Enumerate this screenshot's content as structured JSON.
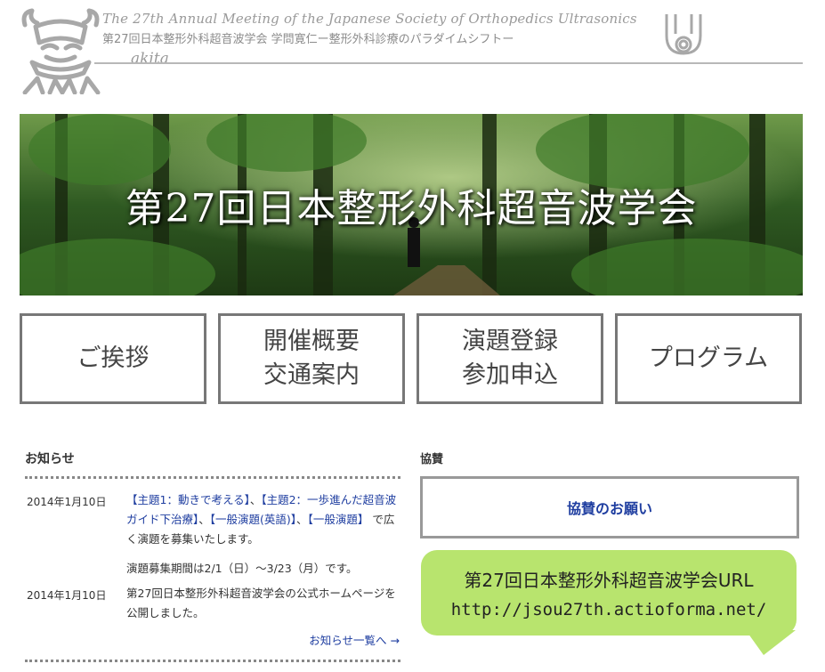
{
  "header": {
    "title_en": "The 27th Annual Meeting of the Japanese Society of Orthopedics Ultrasonics",
    "title_jp": "第27回日本整形外科超音波学会 学問寛仁ー整形外科診療のパラダイムシフトー",
    "city": "akita"
  },
  "hero": {
    "title": "第27回日本整形外科超音波学会"
  },
  "nav": [
    {
      "line1": "ご挨拶",
      "line2": ""
    },
    {
      "line1": "開催概要",
      "line2": "交通案内"
    },
    {
      "line1": "演題登録",
      "line2": "参加申込"
    },
    {
      "line1": "プログラム",
      "line2": ""
    }
  ],
  "news": {
    "heading": "お知らせ",
    "items": [
      {
        "date": "2014年1月10日",
        "link1": "【主題1：動きで考える】",
        "sep1": "、",
        "link2": "【主題2：一歩進んだ超音波ガイド下治療】",
        "sep2": "、",
        "link3": "【一般演題(英語)】",
        "sep3": "、",
        "link4": "【一般演題】",
        "tail": "で広く演題を募集いたします。",
        "note": "演題募集期間は2/1（日）～3/23（月）です。"
      },
      {
        "date": "2014年1月10日",
        "text": "第27回日本整形外科超音波学会の公式ホームページを公開しました。"
      }
    ],
    "more": "お知らせ一覧へ →"
  },
  "sponsor": {
    "heading": "協賛",
    "button": "協賛のお願い"
  },
  "url_bubble": {
    "line1": "第27回日本整形外科超音波学会URL",
    "line2": "http://jsou27th.actioforma.net/"
  },
  "colors": {
    "link": "#1f3ea0",
    "bubble": "#b8e46e",
    "border": "#777777"
  }
}
